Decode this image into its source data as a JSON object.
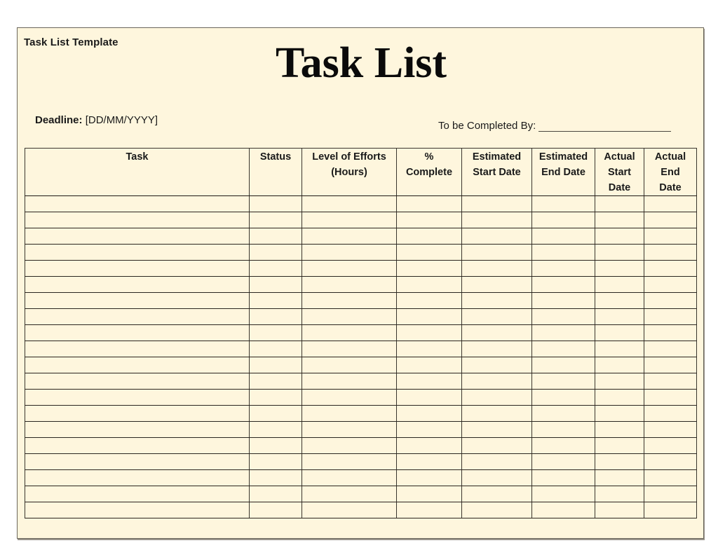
{
  "document": {
    "template_label": "Task List Template",
    "title": "Task List",
    "deadline": {
      "label": "Deadline:",
      "value": "[DD/MM/YYYY]"
    },
    "completed_by": {
      "label": "To be Completed By:",
      "value": ""
    },
    "background_color": "#fef6dd"
  },
  "table": {
    "columns": [
      {
        "key": "task",
        "lines": [
          "Task"
        ]
      },
      {
        "key": "status",
        "lines": [
          "Status"
        ]
      },
      {
        "key": "level_of_efforts",
        "lines": [
          "Level of Efforts",
          "(Hours)"
        ]
      },
      {
        "key": "percent_complete",
        "lines": [
          "%",
          "Complete"
        ]
      },
      {
        "key": "estimated_start_date",
        "lines": [
          "Estimated",
          "Start Date"
        ]
      },
      {
        "key": "estimated_end_date",
        "lines": [
          "Estimated",
          "End Date"
        ]
      },
      {
        "key": "actual_start_date",
        "lines": [
          "Actual",
          "Start",
          "Date"
        ]
      },
      {
        "key": "actual_end_date",
        "lines": [
          "Actual",
          "End",
          "Date"
        ]
      }
    ],
    "rows": [
      [
        "",
        "",
        "",
        "",
        "",
        "",
        "",
        ""
      ],
      [
        "",
        "",
        "",
        "",
        "",
        "",
        "",
        ""
      ],
      [
        "",
        "",
        "",
        "",
        "",
        "",
        "",
        ""
      ],
      [
        "",
        "",
        "",
        "",
        "",
        "",
        "",
        ""
      ],
      [
        "",
        "",
        "",
        "",
        "",
        "",
        "",
        ""
      ],
      [
        "",
        "",
        "",
        "",
        "",
        "",
        "",
        ""
      ],
      [
        "",
        "",
        "",
        "",
        "",
        "",
        "",
        ""
      ],
      [
        "",
        "",
        "",
        "",
        "",
        "",
        "",
        ""
      ],
      [
        "",
        "",
        "",
        "",
        "",
        "",
        "",
        ""
      ],
      [
        "",
        "",
        "",
        "",
        "",
        "",
        "",
        ""
      ],
      [
        "",
        "",
        "",
        "",
        "",
        "",
        "",
        ""
      ],
      [
        "",
        "",
        "",
        "",
        "",
        "",
        "",
        ""
      ],
      [
        "",
        "",
        "",
        "",
        "",
        "",
        "",
        ""
      ],
      [
        "",
        "",
        "",
        "",
        "",
        "",
        "",
        ""
      ],
      [
        "",
        "",
        "",
        "",
        "",
        "",
        "",
        ""
      ],
      [
        "",
        "",
        "",
        "",
        "",
        "",
        "",
        ""
      ],
      [
        "",
        "",
        "",
        "",
        "",
        "",
        "",
        ""
      ],
      [
        "",
        "",
        "",
        "",
        "",
        "",
        "",
        ""
      ],
      [
        "",
        "",
        "",
        "",
        "",
        "",
        "",
        ""
      ],
      [
        "",
        "",
        "",
        "",
        "",
        "",
        "",
        ""
      ]
    ]
  }
}
